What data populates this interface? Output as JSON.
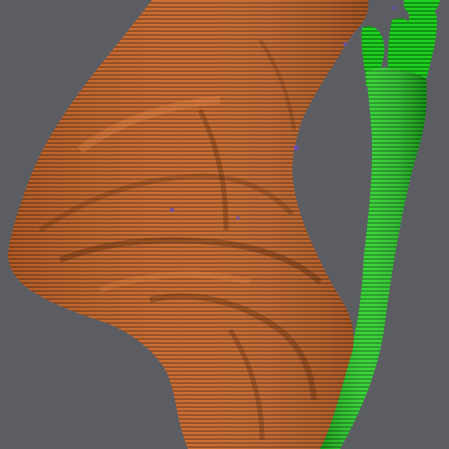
{
  "viewport": {
    "background_color": "#5c5d63"
  },
  "objects": [
    {
      "name": "orange-mesh",
      "fill_color": "#c8672a",
      "stripe_color": "#7a3b16",
      "highlight_color": "#e58544"
    },
    {
      "name": "green-mesh",
      "fill_color": "#1fd21f",
      "stripe_color": "#0c6a0c",
      "highlight_color": "#4cf04c"
    }
  ],
  "markers": {
    "color": "#6a4fb0"
  }
}
